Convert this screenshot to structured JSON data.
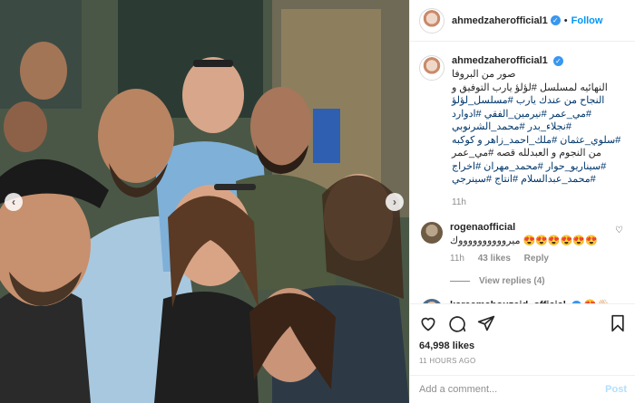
{
  "post": {
    "username": "ahmedzaherofficial1",
    "verified_glyph": "✓",
    "dot": "•",
    "follow_label": "Follow",
    "caption_lines": [
      "صور من البروفا",
      "النهائيه لمسلسل #لؤلؤ يارب التوفيق و",
      "النجاح من عندك يارب #مسلسل_لؤلؤ",
      "#مي_عمر #نيرمين_الفقي #ادوارد",
      "#نجلاء_بدر #محمد_الشرنوبي",
      "#سلوي_عثمان #ملك_احمد_زاهر و كوكبه",
      "من النجوم و العبدلله قصه #مي_عمر",
      "#سيناريو_حوار #محمد_مهران #اخراج",
      "#محمد_عبدالسلام #انتاج #سينرجي"
    ],
    "caption_time": "11h"
  },
  "comments": [
    {
      "username": "rogenaofficial",
      "text": "ميرووووووووووك 😍😍😍😍😍😍",
      "time": "11h",
      "likes": "43 likes",
      "reply_label": "Reply",
      "view_replies": "View replies (4)",
      "heart_icon": "heart-outline-icon"
    },
    {
      "username": "kareemabouzeid_official",
      "text": "😍👋🏻",
      "verified": true
    }
  ],
  "actions": {
    "likes_count": "64,998 likes",
    "time_ago": "11 HOURS AGO"
  },
  "add_comment": {
    "placeholder": "Add a comment...",
    "post_label": "Post"
  },
  "carousel": {
    "prev_glyph": "‹",
    "next_glyph": "›"
  },
  "colors": {
    "accent": "#0095f6",
    "verified": "#3897f0",
    "muted": "#8e8e8e",
    "hashtag": "#00376b",
    "post_disabled": "#b2dffc"
  }
}
